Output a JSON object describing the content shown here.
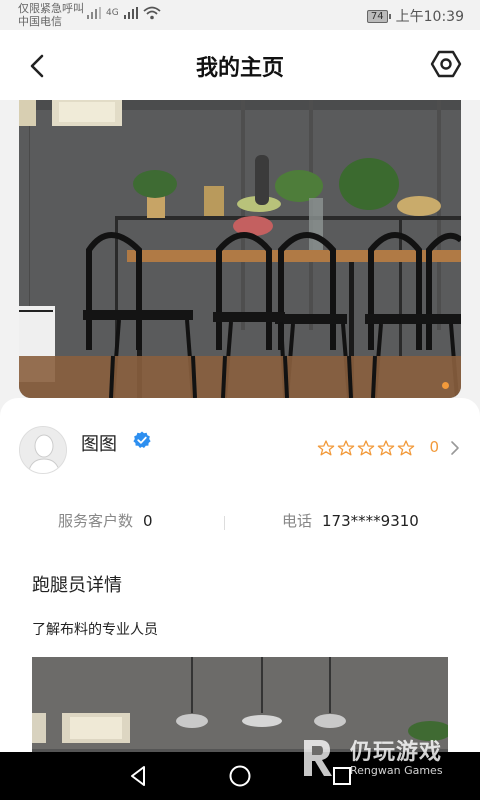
{
  "status": {
    "notice_line1": "仅限紧急呼叫",
    "notice_line2": "中国电信",
    "network": "4G",
    "battery": "74",
    "time": "上午10:39"
  },
  "nav": {
    "title": "我的主页",
    "back_icon": "back-arrow-icon",
    "settings_icon": "settings-gear-icon"
  },
  "profile": {
    "name": "图图",
    "verified_icon": "verified-check-icon",
    "rating": "0",
    "stars_filled": 0,
    "stars_total": 5,
    "star_color": "#f29a3b"
  },
  "stats": {
    "customers_label": "服务客户数",
    "customers_value": "0",
    "phone_label": "电话",
    "phone_value": "173****9310"
  },
  "detail": {
    "section_title": "跑腿员详情",
    "description": "了解布料的专业人员"
  },
  "watermark": {
    "title": "仍玩游戏",
    "subtitle": "Rengwan Games"
  },
  "carousel": {
    "active_dot_color": "#f29a3b"
  }
}
